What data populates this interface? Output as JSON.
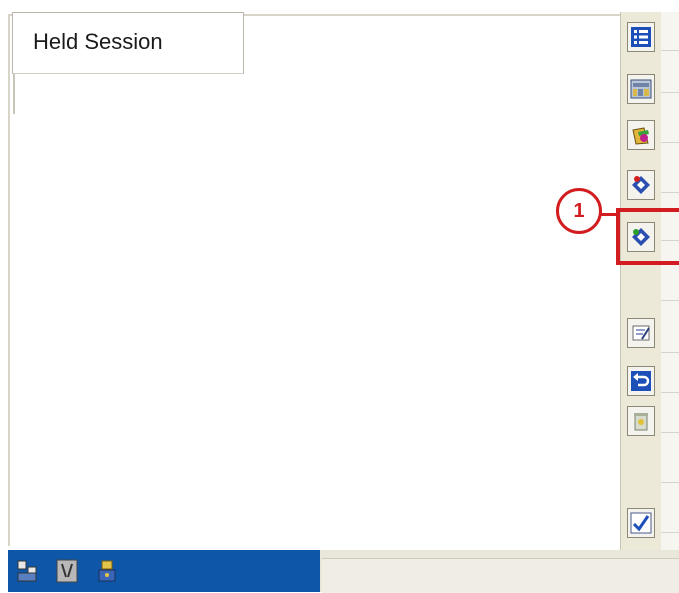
{
  "main": {
    "held_session_label": "Held Session"
  },
  "toolbar": {
    "buttons": [
      {
        "icon": "list-icon"
      },
      {
        "icon": "keyboard-icon"
      },
      {
        "icon": "paint-icon"
      },
      {
        "icon": "disk-remove-icon"
      },
      {
        "icon": "disk-save-icon"
      },
      {
        "icon": "edit-note-icon"
      },
      {
        "icon": "undo-icon"
      },
      {
        "icon": "recycle-bin-icon"
      },
      {
        "icon": "checkmark-icon"
      }
    ]
  },
  "callout": {
    "number": "1",
    "color": "#d21c20"
  },
  "taskbar": {
    "color": "#0e57a8",
    "icons": [
      "user-tree-icon",
      "tools-icon",
      "lock-user-icon"
    ]
  }
}
